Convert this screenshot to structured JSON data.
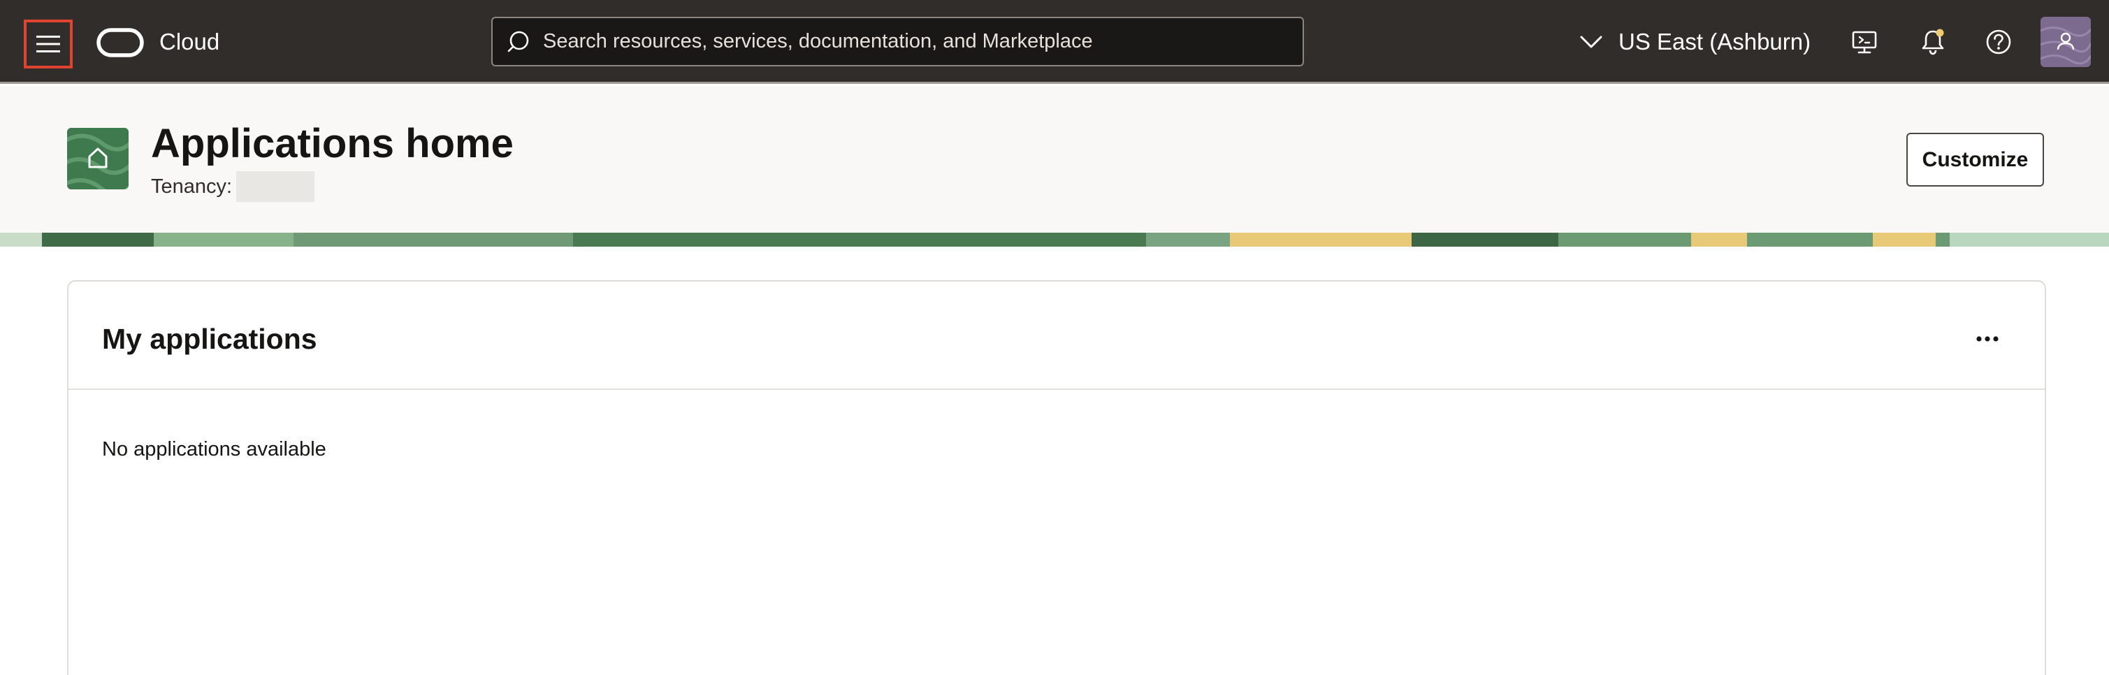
{
  "colors": {
    "topbar_bg": "#312d2a",
    "annotation": "#e0442e",
    "header_bg": "#f9f8f6",
    "accent_green": "#3f7a4e",
    "notification_dot": "#f0cc71"
  },
  "topbar": {
    "brand": "Cloud",
    "search_placeholder": "Search resources, services, documentation, and Marketplace",
    "region": "US East (Ashburn)",
    "icons": [
      "menu-icon",
      "oracle-logo",
      "search-icon",
      "chevron-down-icon",
      "cloud-shell-icon",
      "bell-icon",
      "help-icon",
      "user-icon"
    ]
  },
  "page": {
    "title": "Applications home",
    "tenancy_label": "Tenancy:",
    "tenancy_value": "",
    "customize_label": "Customize"
  },
  "card": {
    "title": "My applications",
    "empty_message": "No applications available",
    "menu_icon": "more-icon"
  }
}
